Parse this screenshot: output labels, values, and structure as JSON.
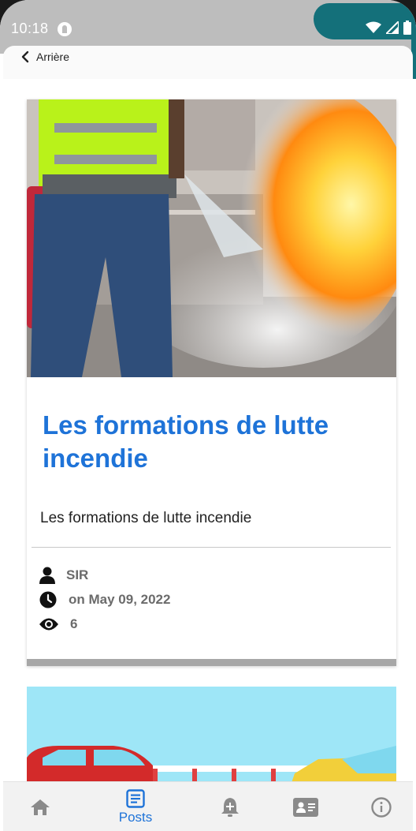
{
  "status_bar": {
    "time": "10:18"
  },
  "header": {
    "back_label": "Arrière"
  },
  "post": {
    "title": "Les formations de lutte incendie",
    "excerpt": "Les formations de lutte incendie",
    "author": "SIR",
    "date": "on May 09, 2022",
    "views": "6"
  },
  "bottom_nav": {
    "items": [
      {
        "icon": "home-icon",
        "label": ""
      },
      {
        "icon": "posts-icon",
        "label": "Posts",
        "active": true
      },
      {
        "icon": "bell-plus-icon",
        "label": ""
      },
      {
        "icon": "contact-card-icon",
        "label": ""
      },
      {
        "icon": "info-icon",
        "label": ""
      }
    ]
  },
  "colors": {
    "accent": "#1e73d8",
    "teal": "#14707a",
    "status_bar": "#bdbdbd",
    "icon_gray": "#8a8a8a"
  }
}
